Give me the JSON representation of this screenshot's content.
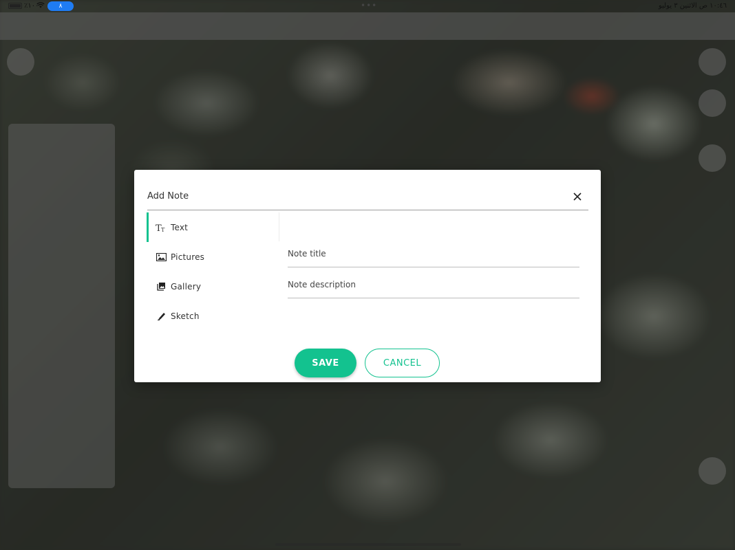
{
  "status_bar": {
    "battery_text": "٪١٠٠",
    "vpn_badge": "٨",
    "time_text": "١٠:٤٦ ص   الاثنين ٣ يوليو"
  },
  "modal": {
    "title": "Add Note",
    "close_icon": "close-icon",
    "tabs": [
      {
        "label": "Text",
        "icon": "text-format-icon",
        "active": true
      },
      {
        "label": "Pictures",
        "icon": "picture-icon",
        "active": false
      },
      {
        "label": "Gallery",
        "icon": "gallery-icon",
        "active": false
      },
      {
        "label": "Sketch",
        "icon": "pen-icon",
        "active": false
      }
    ],
    "note_title_placeholder": "Note title",
    "note_description_placeholder": "Note description",
    "save_label": "SAVE",
    "cancel_label": "CANCEL"
  },
  "colors": {
    "accent": "#13c28f",
    "status_pill": "#1f7cf3"
  }
}
